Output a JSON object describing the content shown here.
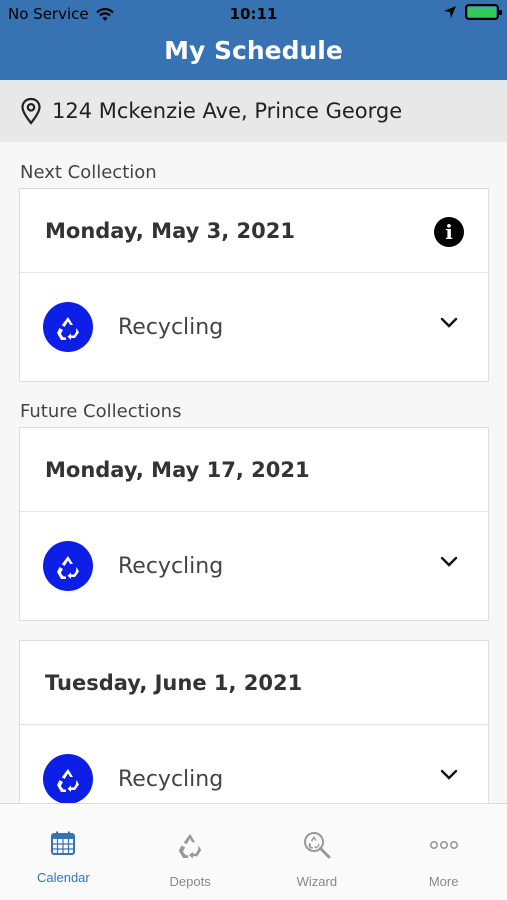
{
  "status_bar": {
    "carrier": "No Service",
    "time": "10:11"
  },
  "header": {
    "title": "My Schedule"
  },
  "address": {
    "icon": "location-pin-icon",
    "text": "124 Mckenzie Ave, Prince George"
  },
  "next_collection": {
    "label": "Next Collection",
    "date": "Monday, May 3, 2021",
    "items": [
      {
        "label": "Recycling",
        "icon": "recycle-icon"
      }
    ]
  },
  "future_collections": {
    "label": "Future Collections",
    "entries": [
      {
        "date": "Monday, May 17, 2021",
        "items": [
          {
            "label": "Recycling",
            "icon": "recycle-icon"
          }
        ]
      },
      {
        "date": "Tuesday, June 1, 2021",
        "items": [
          {
            "label": "Recycling",
            "icon": "recycle-icon"
          }
        ]
      }
    ]
  },
  "tab_bar": {
    "tabs": [
      {
        "label": "Calendar",
        "icon": "calendar-icon",
        "active": true
      },
      {
        "label": "Depots",
        "icon": "recycle-icon",
        "active": false
      },
      {
        "label": "Wizard",
        "icon": "search-recycle-icon",
        "active": false
      },
      {
        "label": "More",
        "icon": "more-icon",
        "active": false
      }
    ]
  },
  "colors": {
    "brand": "#3773b3",
    "badge": "#0d1fe6",
    "battery": "#34c759"
  }
}
